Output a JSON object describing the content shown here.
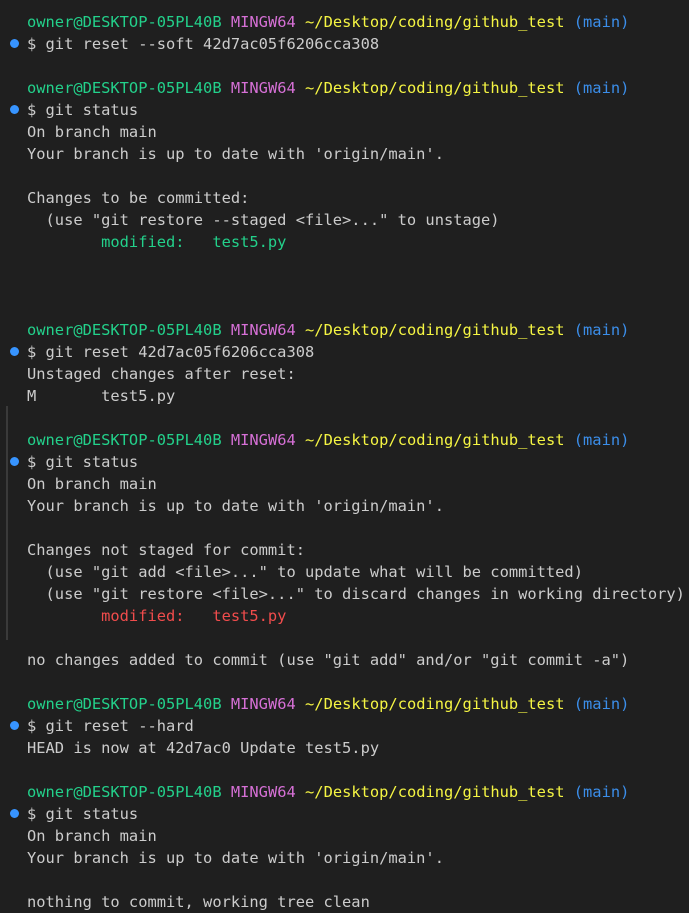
{
  "prompt": {
    "user_host": "owner@DESKTOP-05PL40B",
    "system": "MINGW64",
    "path": "~/Desktop/coding/github_test",
    "branch": "(main)"
  },
  "blocks": [
    {
      "command": "$ git reset --soft 42d7ac05f6206cca308",
      "output": []
    },
    {
      "command": "$ git status",
      "output": [
        {
          "text": "On branch main",
          "color": "default"
        },
        {
          "text": "Your branch is up to date with 'origin/main'.",
          "color": "default"
        },
        {
          "text": "",
          "color": "default"
        },
        {
          "text": "Changes to be committed:",
          "color": "default"
        },
        {
          "text": "  (use \"git restore --staged <file>...\" to unstage)",
          "color": "default"
        },
        {
          "text": "        modified:   test5.py",
          "color": "green"
        },
        {
          "text": "",
          "color": "default"
        },
        {
          "text": "",
          "color": "default"
        }
      ]
    },
    {
      "command": "$ git reset 42d7ac05f6206cca308",
      "output": [
        {
          "text": "Unstaged changes after reset:",
          "color": "default"
        },
        {
          "text": "M       test5.py",
          "color": "default"
        }
      ]
    },
    {
      "command": "$ git status",
      "output": [
        {
          "text": "On branch main",
          "color": "default"
        },
        {
          "text": "Your branch is up to date with 'origin/main'.",
          "color": "default"
        },
        {
          "text": "",
          "color": "default"
        },
        {
          "text": "Changes not staged for commit:",
          "color": "default"
        },
        {
          "text": "  (use \"git add <file>...\" to update what will be committed)",
          "color": "default"
        },
        {
          "text": "  (use \"git restore <file>...\" to discard changes in working directory)",
          "color": "default"
        },
        {
          "text": "        modified:   test5.py",
          "color": "red"
        },
        {
          "text": "",
          "color": "default"
        },
        {
          "text": "no changes added to commit (use \"git add\" and/or \"git commit -a\")",
          "color": "default"
        }
      ]
    },
    {
      "command": "$ git reset --hard",
      "output": [
        {
          "text": "HEAD is now at 42d7ac0 Update test5.py",
          "color": "default"
        }
      ]
    },
    {
      "command": "$ git status",
      "output": [
        {
          "text": "On branch main",
          "color": "default"
        },
        {
          "text": "Your branch is up to date with 'origin/main'.",
          "color": "default"
        },
        {
          "text": "",
          "color": "default"
        },
        {
          "text": "nothing to commit, working tree clean",
          "color": "default"
        }
      ]
    }
  ],
  "colors": {
    "background": "#1f1f1f",
    "user_host": "#23d18b",
    "system": "#d670d6",
    "path": "#f5f543",
    "branch": "#3b8eea",
    "text": "#cccccc",
    "staged": "#23d18b",
    "unstaged": "#f14c4c",
    "command_marker": "#3794ff"
  },
  "icons": {
    "command_marker": "command-decoration-icon"
  }
}
